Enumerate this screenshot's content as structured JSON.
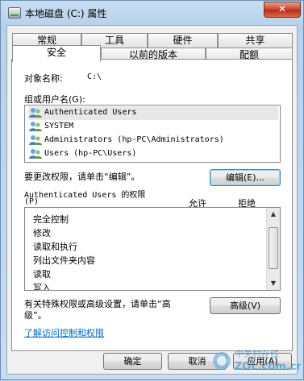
{
  "window": {
    "title": "本地磁盘 (C:) 属性",
    "close_glyph": "✕"
  },
  "tabs": {
    "row1": [
      "常规",
      "工具",
      "硬件",
      "共享"
    ],
    "row2": [
      "安全",
      "以前的版本",
      "配额"
    ]
  },
  "security": {
    "object_name_label": "对象名称:",
    "object_name_value": "C:\\",
    "group_label": "组或用户名(G):",
    "users": [
      "Authenticated Users",
      "SYSTEM",
      "Administrators (hp-PC\\Administrators)",
      "Users (hp-PC\\Users)"
    ],
    "change_perm_text": "要更改权限，请单击“编辑”。",
    "edit_button": "编辑(E)...",
    "perm_for_line1": "Authenticated Users 的权限",
    "perm_for_line2": "(P)",
    "allow_header": "允许",
    "deny_header": "拒绝",
    "permissions": [
      "完全控制",
      "修改",
      "读取和执行",
      "列出文件夹内容",
      "读取",
      "写入"
    ],
    "advanced_text_line1": "有关特殊权限或高级设置，请单击“高",
    "advanced_text_line2": "级”。",
    "advanced_button": "高级(V)",
    "learn_link": "了解访问控制和权限"
  },
  "footer": {
    "ok": "确定",
    "cancel": "取消",
    "apply": "应用(A)"
  },
  "watermark": {
    "line1": "中关村在线",
    "line2": "ZOL.com.cn"
  },
  "colors": {
    "accent": "#3c7fb1",
    "link": "#0066cc",
    "close": "#c7412b"
  }
}
